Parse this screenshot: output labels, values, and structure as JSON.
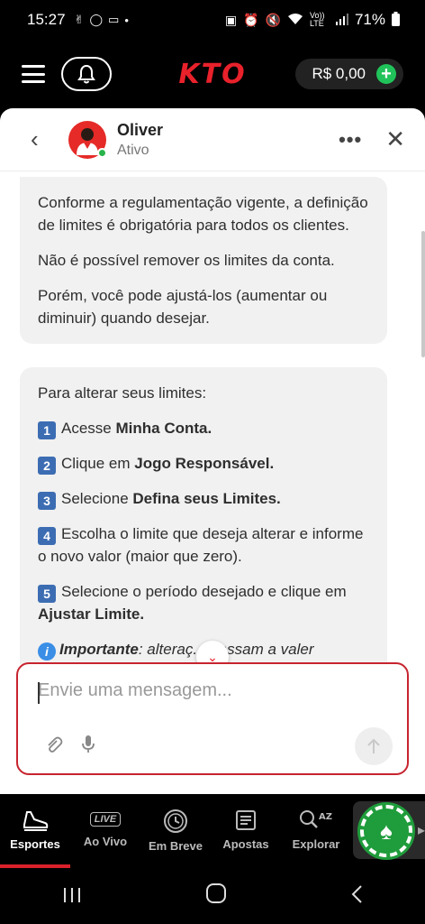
{
  "status_bar": {
    "time": "15:27",
    "battery": "71%",
    "network": "Vo)) LTE"
  },
  "app_bar": {
    "logo": "KTO",
    "balance": "R$ 0,00",
    "brand_color": "#e8212b"
  },
  "chat": {
    "agent_name": "Oliver",
    "agent_status": "Ativo",
    "message1": {
      "p1": "Conforme a regulamentação vigente, a definição de limites é obrigatória para todos os clientes.",
      "p2": "Não é possível remover os limites da conta.",
      "p3": "Porém, você pode ajustá-los (aumentar ou diminuir) quando desejar."
    },
    "message2": {
      "intro": "Para alterar seus limites:",
      "steps": [
        {
          "num": "1",
          "text": "Acesse ",
          "bold": "Minha Conta."
        },
        {
          "num": "2",
          "text": "Clique em ",
          "bold": "Jogo Responsável."
        },
        {
          "num": "3",
          "text": "Selecione ",
          "bold": "Defina seus Limites."
        },
        {
          "num": "4",
          "text": "Escolha o limite que deseja alterar e informe o novo valor (maior que zero).",
          "bold": ""
        },
        {
          "num": "5",
          "text": "Selecione o período desejado e clique em ",
          "bold": "Ajustar Limite."
        }
      ],
      "important_label": "Importante",
      "important_text": ": alteraç... passam a valer"
    },
    "composer_placeholder": "Envie uma mensagem..."
  },
  "bottom_nav": {
    "items": [
      {
        "label": "Esportes"
      },
      {
        "label": "Ao Vivo",
        "badge": "LIVE"
      },
      {
        "label": "Em Breve"
      },
      {
        "label": "Apostas"
      },
      {
        "label": "Explorar"
      }
    ]
  }
}
